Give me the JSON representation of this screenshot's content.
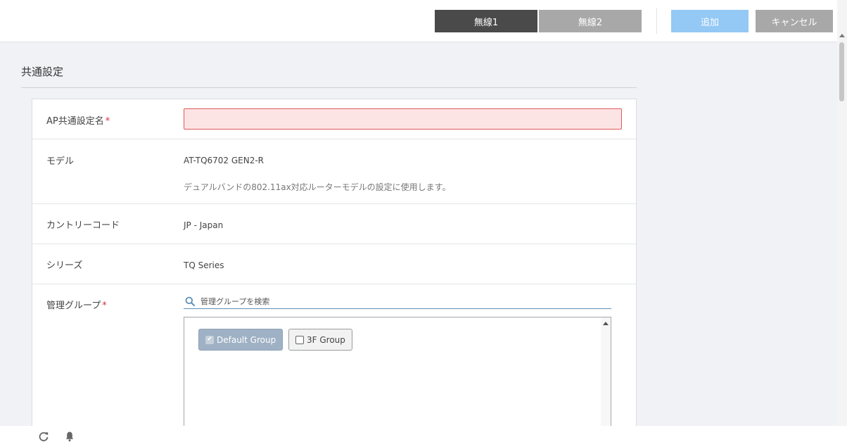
{
  "header": {
    "tabs": [
      {
        "label": "無線1",
        "active": true
      },
      {
        "label": "無線2",
        "active": false
      }
    ],
    "add_label": "追加",
    "cancel_label": "キャンセル"
  },
  "section": {
    "title": "共通設定"
  },
  "form": {
    "ap_name": {
      "label": "AP共通設定名",
      "required_mark": "*",
      "value": ""
    },
    "model": {
      "label": "モデル",
      "value": "AT-TQ6702 GEN2-R",
      "description": "デュアルバンドの802.11ax対応ルーターモデルの設定に使用します。"
    },
    "country": {
      "label": "カントリーコード",
      "value": "JP - Japan"
    },
    "series": {
      "label": "シリーズ",
      "value": "TQ Series"
    },
    "mgmt_group": {
      "label": "管理グループ",
      "required_mark": "*",
      "search_placeholder": "管理グループを検索",
      "groups": [
        {
          "label": "Default Group",
          "checked": true
        },
        {
          "label": "3F Group",
          "checked": false
        }
      ]
    }
  },
  "colors": {
    "tab_active": "#4a4a4a",
    "tab_inactive": "#a8a8a8",
    "add_button": "#94c8f5",
    "required": "#d9303b",
    "error_field": "#fde4e4"
  },
  "icons": {
    "search": "search-icon",
    "refresh": "refresh-icon",
    "notification": "bell-icon"
  }
}
